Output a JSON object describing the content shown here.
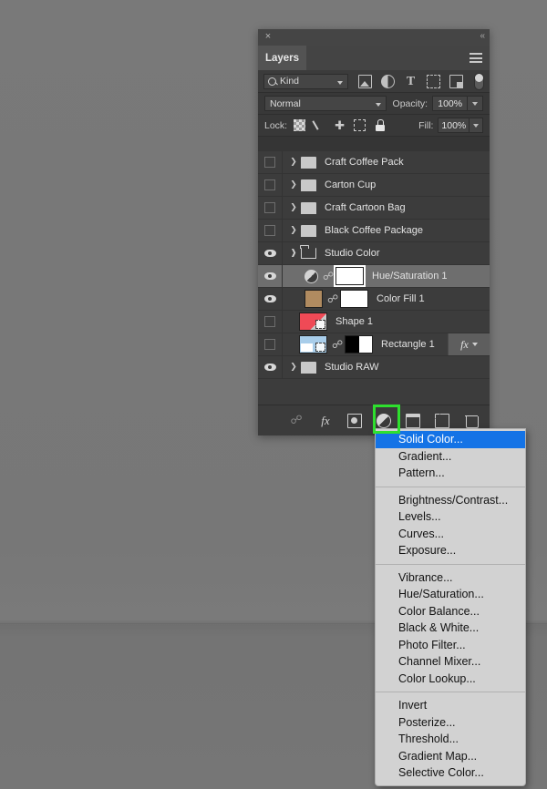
{
  "panel": {
    "close_label": "×",
    "collapse_label": "«",
    "tab_label": "Layers",
    "menu_icon": "hamburger-menu-icon"
  },
  "filter_row": {
    "kind_label": "Kind",
    "search_icon": "search-icon",
    "icons": [
      {
        "name": "filter-pixel-icon",
        "label": ""
      },
      {
        "name": "filter-adjustment-icon",
        "label": ""
      },
      {
        "name": "filter-type-icon",
        "label": "T"
      },
      {
        "name": "filter-shape-icon",
        "label": ""
      },
      {
        "name": "filter-smartobject-icon",
        "label": ""
      },
      {
        "name": "filter-toggle-switch",
        "label": ""
      }
    ]
  },
  "blend_row": {
    "mode": "Normal",
    "opacity_label": "Opacity:",
    "opacity_value": "100%"
  },
  "lock_row": {
    "lock_label": "Lock:",
    "fill_label": "Fill:",
    "fill_value": "100%",
    "icons": [
      "lock-transparent-pixels-icon",
      "lock-image-pixels-icon",
      "lock-position-icon",
      "lock-artboard-nesting-icon",
      "lock-all-icon"
    ]
  },
  "layers": [
    {
      "name": "Craft Coffee Pack",
      "visible": false,
      "type": "group",
      "expanded": false,
      "selected": false
    },
    {
      "name": "Carton Cup",
      "visible": false,
      "type": "group",
      "expanded": false,
      "selected": false
    },
    {
      "name": "Craft Cartoon Bag",
      "visible": false,
      "type": "group",
      "expanded": false,
      "selected": false
    },
    {
      "name": "Black Coffee Package",
      "visible": false,
      "type": "group",
      "expanded": false,
      "selected": false
    },
    {
      "name": "Studio Color",
      "visible": true,
      "type": "group",
      "expanded": true,
      "selected": false
    },
    {
      "name": "Hue/Saturation 1",
      "visible": true,
      "type": "adjustment",
      "expanded": false,
      "selected": true,
      "swatch": ""
    },
    {
      "name": "Color Fill 1",
      "visible": true,
      "type": "fill",
      "expanded": false,
      "selected": false,
      "swatch": "#b08b60"
    },
    {
      "name": "Shape 1",
      "visible": false,
      "type": "shape-red",
      "expanded": false,
      "selected": false,
      "swatch": "#ef4a56"
    },
    {
      "name": "Rectangle 1",
      "visible": false,
      "type": "shape-blue",
      "expanded": false,
      "selected": false,
      "swatch": "#a8cdea",
      "fx": "fx"
    },
    {
      "name": "Studio RAW",
      "visible": true,
      "type": "group",
      "expanded": false,
      "selected": false
    }
  ],
  "bottom_toolbar": [
    {
      "name": "link-layers-button",
      "label": ""
    },
    {
      "name": "layer-style-fx-button",
      "label": "fx"
    },
    {
      "name": "add-layer-mask-button",
      "label": ""
    },
    {
      "name": "new-adjustment-layer-button",
      "label": ""
    },
    {
      "name": "new-group-button",
      "label": ""
    },
    {
      "name": "new-layer-button",
      "label": ""
    },
    {
      "name": "delete-layer-button",
      "label": ""
    }
  ],
  "highlight": {
    "target": "new-adjustment-layer-button",
    "color": "#2ee02e"
  },
  "context_menu": {
    "groups": [
      {
        "items": [
          {
            "label": "Solid Color...",
            "active": true
          },
          {
            "label": "Gradient...",
            "active": false
          },
          {
            "label": "Pattern...",
            "active": false
          }
        ]
      },
      {
        "items": [
          {
            "label": "Brightness/Contrast...",
            "active": false
          },
          {
            "label": "Levels...",
            "active": false
          },
          {
            "label": "Curves...",
            "active": false
          },
          {
            "label": "Exposure...",
            "active": false
          }
        ]
      },
      {
        "items": [
          {
            "label": "Vibrance...",
            "active": false
          },
          {
            "label": "Hue/Saturation...",
            "active": false
          },
          {
            "label": "Color Balance...",
            "active": false
          },
          {
            "label": "Black & White...",
            "active": false
          },
          {
            "label": "Photo Filter...",
            "active": false
          },
          {
            "label": "Channel Mixer...",
            "active": false
          },
          {
            "label": "Color Lookup...",
            "active": false
          }
        ]
      },
      {
        "items": [
          {
            "label": "Invert",
            "active": false
          },
          {
            "label": "Posterize...",
            "active": false
          },
          {
            "label": "Threshold...",
            "active": false
          },
          {
            "label": "Gradient Map...",
            "active": false
          },
          {
            "label": "Selective Color...",
            "active": false
          }
        ]
      }
    ]
  },
  "colors": {
    "panel_bg": "#353535",
    "list_bg": "#3c3c3c",
    "selected_row": "#6e6e6e",
    "menu_bg": "#d2d2d2",
    "menu_highlight": "#1473e6",
    "canvas_bg": "#757575"
  }
}
